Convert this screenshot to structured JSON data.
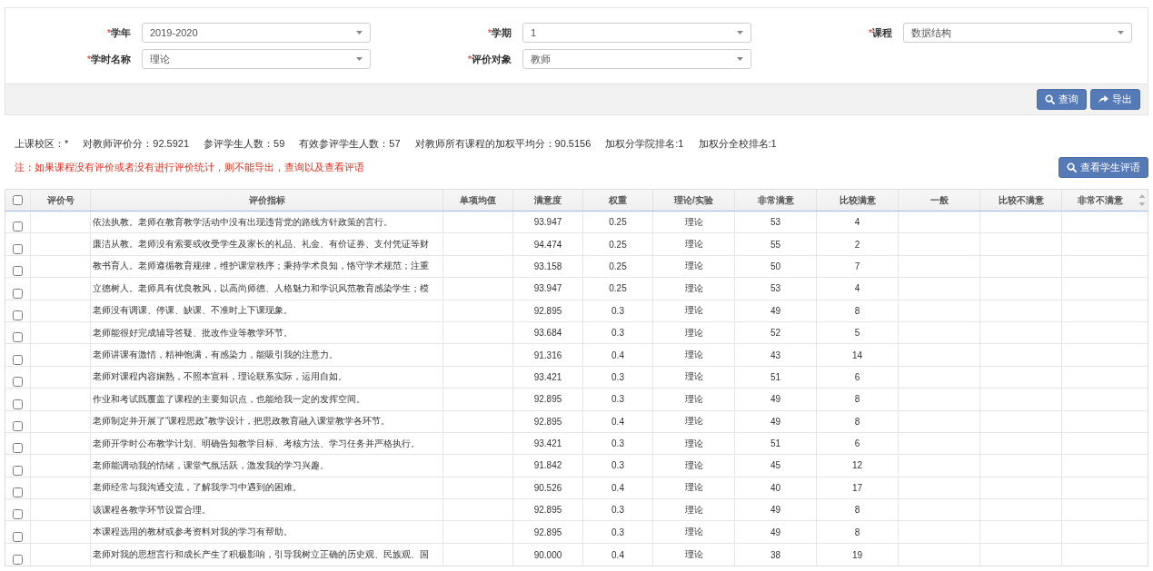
{
  "filters": [
    {
      "required_mark": "*",
      "label": "学年",
      "value": "2019-2020"
    },
    {
      "required_mark": "*",
      "label": "学期",
      "value": "1"
    },
    {
      "required_mark": "*",
      "label": "课程",
      "value": "数据结构"
    },
    {
      "required_mark": "*",
      "label": "学时名称",
      "value": "理论"
    },
    {
      "required_mark": "*",
      "label": "评价对象",
      "value": "教师"
    }
  ],
  "actions": [
    {
      "kind": "query",
      "label": "查询"
    },
    {
      "kind": "export",
      "label": "导出"
    }
  ],
  "stats": [
    "上课校区：*",
    "对教师评价分：92.5921",
    "参评学生人数：59",
    "有效参评学生人数：57",
    "对教师所有课程的加权平均分：90.5156",
    "加权分学院排名:1",
    "加权分全校排名:1"
  ],
  "notice": "注：如果课程没有评价或者没有进行评价统计，则不能导出，查询以及查看评语",
  "comments_button": {
    "label": "查看学生评语"
  },
  "table": {
    "select_all": {
      "checked": false
    },
    "columns": [
      "评价号",
      "评价指标",
      "单项均值",
      "满意度",
      "权重",
      "理论/实验",
      "非常满意",
      "比较满意",
      "一般",
      "比较不满意",
      "非常不满意"
    ],
    "rows": [
      {
        "checked": false,
        "indicator": "依法执教。老师在教育教学活动中没有出现违背党的路线方针政策的言行。",
        "satisfaction": "93.947",
        "weight": "0.25",
        "category": "理论",
        "very_satisfied": "53",
        "fairly_satisfied": "4"
      },
      {
        "checked": false,
        "indicator": "廉洁从教。老师没有索要或收受学生及家长的礼品、礼金、有价证券、支付凭证等财",
        "satisfaction": "94.474",
        "weight": "0.25",
        "category": "理论",
        "very_satisfied": "55",
        "fairly_satisfied": "2"
      },
      {
        "checked": false,
        "indicator": "教书育人。老师遵循教育规律，维护课堂秩序；秉持学术良知，恪守学术规范；注重",
        "satisfaction": "93.158",
        "weight": "0.25",
        "category": "理论",
        "very_satisfied": "50",
        "fairly_satisfied": "7"
      },
      {
        "checked": false,
        "indicator": "立德树人。老师具有优良教风，以高尚师德、人格魅力和学识风范教育感染学生；模",
        "satisfaction": "93.947",
        "weight": "0.25",
        "category": "理论",
        "very_satisfied": "53",
        "fairly_satisfied": "4"
      },
      {
        "checked": false,
        "indicator": "老师没有调课、停课、缺课、不准时上下课现象。",
        "satisfaction": "92.895",
        "weight": "0.3",
        "category": "理论",
        "very_satisfied": "49",
        "fairly_satisfied": "8"
      },
      {
        "checked": false,
        "indicator": "老师能很好完成辅导答疑、批改作业等教学环节。",
        "satisfaction": "93.684",
        "weight": "0.3",
        "category": "理论",
        "very_satisfied": "52",
        "fairly_satisfied": "5"
      },
      {
        "checked": false,
        "indicator": "老师讲课有激情，精神饱满，有感染力，能吸引我的注意力。",
        "satisfaction": "91.316",
        "weight": "0.4",
        "category": "理论",
        "very_satisfied": "43",
        "fairly_satisfied": "14"
      },
      {
        "checked": false,
        "indicator": "老师对课程内容娴熟，不照本宣科，理论联系实际，运用自如。",
        "satisfaction": "93.421",
        "weight": "0.3",
        "category": "理论",
        "very_satisfied": "51",
        "fairly_satisfied": "6"
      },
      {
        "checked": false,
        "indicator": "作业和考试既覆盖了课程的主要知识点，也能给我一定的发挥空间。",
        "satisfaction": "92.895",
        "weight": "0.3",
        "category": "理论",
        "very_satisfied": "49",
        "fairly_satisfied": "8"
      },
      {
        "checked": false,
        "indicator": "老师制定并开展了“课程思政”教学设计，把思政教育融入课堂教学各环节。",
        "satisfaction": "92.895",
        "weight": "0.4",
        "category": "理论",
        "very_satisfied": "49",
        "fairly_satisfied": "8"
      },
      {
        "checked": false,
        "indicator": "老师开学时公布教学计划、明确告知教学目标、考核方法、学习任务并严格执行。",
        "satisfaction": "93.421",
        "weight": "0.3",
        "category": "理论",
        "very_satisfied": "51",
        "fairly_satisfied": "6"
      },
      {
        "checked": false,
        "indicator": "老师能调动我的情绪，课堂气氛活跃，激发我的学习兴趣。",
        "satisfaction": "91.842",
        "weight": "0.3",
        "category": "理论",
        "very_satisfied": "45",
        "fairly_satisfied": "12"
      },
      {
        "checked": false,
        "indicator": "老师经常与我沟通交流，了解我学习中遇到的困难。",
        "satisfaction": "90.526",
        "weight": "0.4",
        "category": "理论",
        "very_satisfied": "40",
        "fairly_satisfied": "17"
      },
      {
        "checked": false,
        "indicator": "该课程各教学环节设置合理。",
        "satisfaction": "92.895",
        "weight": "0.3",
        "category": "理论",
        "very_satisfied": "49",
        "fairly_satisfied": "8"
      },
      {
        "checked": false,
        "indicator": "本课程选用的教材或参考资料对我的学习有帮助。",
        "satisfaction": "92.895",
        "weight": "0.3",
        "category": "理论",
        "very_satisfied": "49",
        "fairly_satisfied": "8"
      },
      {
        "checked": false,
        "indicator": "老师对我的思想言行和成长产生了积极影响，引导我树立正确的历史观、民族观、国",
        "satisfaction": "90.000",
        "weight": "0.4",
        "category": "理论",
        "very_satisfied": "38",
        "fairly_satisfied": "19"
      }
    ]
  }
}
